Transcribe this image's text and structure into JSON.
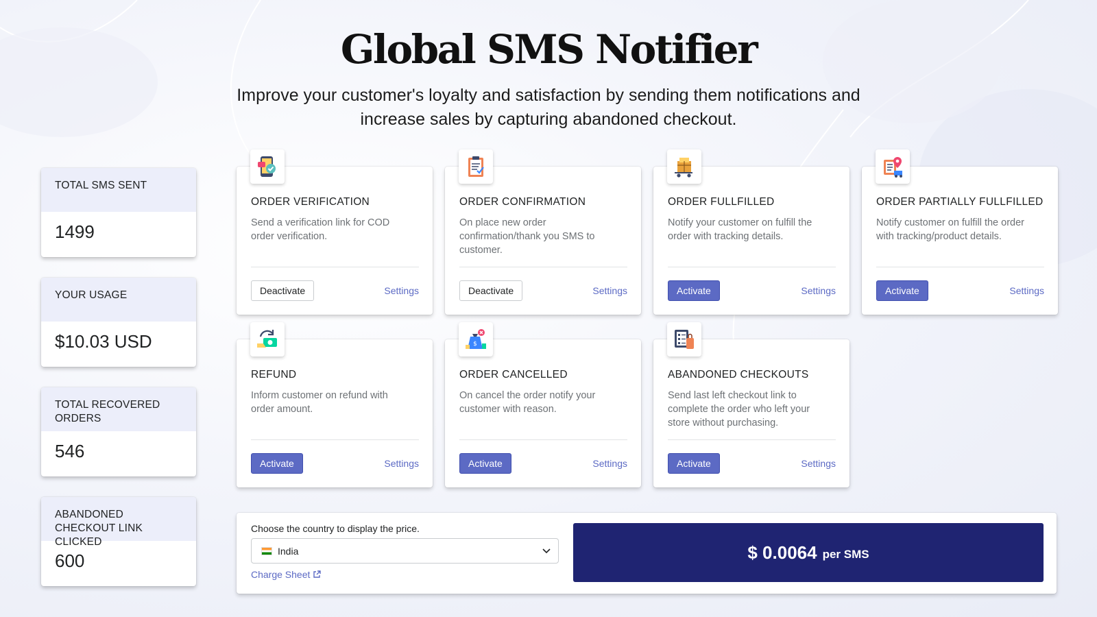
{
  "header": {
    "title": "Global SMS Notifier",
    "subtitle_line1": "Improve your customer's loyalty and satisfaction by sending them notifications and",
    "subtitle_line2": "increase sales by capturing abandoned checkout."
  },
  "stats": [
    {
      "label": "TOTAL SMS SENT",
      "value": "1499"
    },
    {
      "label": "YOUR USAGE",
      "value": "$10.03 USD"
    },
    {
      "label": "TOTAL RECOVERED ORDERS",
      "value": "546"
    },
    {
      "label": "ABANDONED CHECKOUT LINK CLICKED",
      "value": "600"
    }
  ],
  "cards": [
    {
      "title": "ORDER VERIFICATION",
      "description": "Send a verification link for COD order verification.",
      "button": "Deactivate",
      "button_style": "outline",
      "settings": "Settings",
      "icon": "phone-verification-icon"
    },
    {
      "title": "ORDER CONFIRMATION",
      "description": "On place new order confirmation/thank you SMS to customer.",
      "button": "Deactivate",
      "button_style": "outline",
      "settings": "Settings",
      "icon": "clipboard-check-icon"
    },
    {
      "title": "ORDER FULLFILLED",
      "description": "Notify your customer on fulfill the order with tracking details.",
      "button": "Activate",
      "button_style": "primary",
      "settings": "Settings",
      "icon": "delivery-cart-icon"
    },
    {
      "title": "ORDER PARTIALLY FULLFILLED",
      "description": "Notify customer on fulfill the order with tracking/product details.",
      "button": "Activate",
      "button_style": "primary",
      "settings": "Settings",
      "icon": "delivery-truck-location-icon"
    },
    {
      "title": "REFUND",
      "description": "Inform customer on refund with order amount.",
      "button": "Activate",
      "button_style": "primary",
      "settings": "Settings",
      "icon": "refund-money-icon"
    },
    {
      "title": "ORDER CANCELLED",
      "description": "On cancel the order notify your customer with reason.",
      "button": "Activate",
      "button_style": "primary",
      "settings": "Settings",
      "icon": "money-bag-cancel-icon"
    },
    {
      "title": "ABANDONED CHECKOUTS",
      "description": "Send last left checkout link to complete the order who left your store without purchasing.",
      "button": "Activate",
      "button_style": "primary",
      "settings": "Settings",
      "icon": "checklist-bag-icon"
    }
  ],
  "pricing": {
    "choose_label": "Choose the country to display the price.",
    "selected_country": "India",
    "charge_sheet_link": "Charge Sheet",
    "price": "$ 0.0064",
    "unit": "per SMS"
  },
  "colors": {
    "accent": "#5c6ac4",
    "price_box": "#1f2472",
    "stat_header": "#eceefa"
  }
}
